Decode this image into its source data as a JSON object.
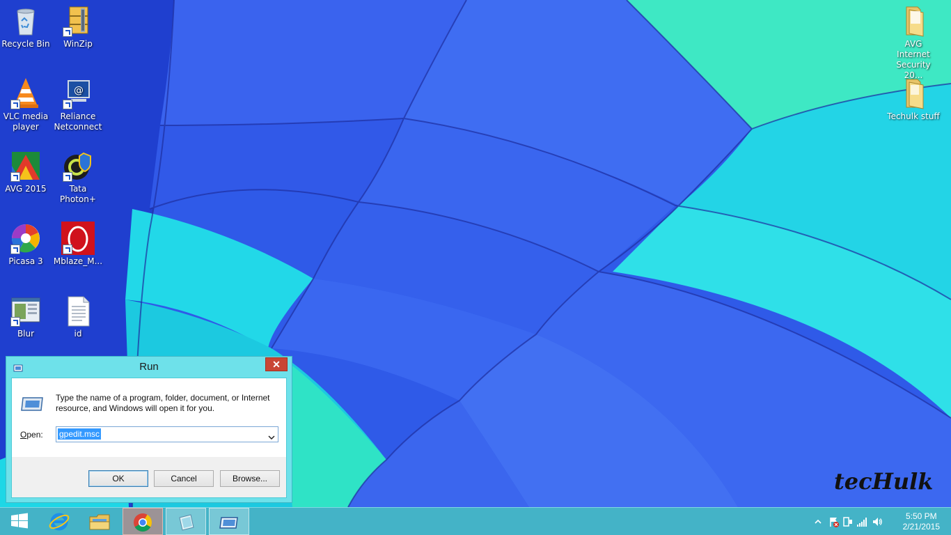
{
  "desktop": {
    "icons": [
      {
        "label": "Recycle Bin",
        "icon": "recycle-bin-icon"
      },
      {
        "label": "WinZip",
        "icon": "winzip-icon"
      },
      {
        "label": "VLC media player",
        "icon": "vlc-icon"
      },
      {
        "label": "Reliance Netconnect",
        "icon": "reliance-netconnect-icon"
      },
      {
        "label": "AVG 2015",
        "icon": "avg-icon"
      },
      {
        "label": "Tata Photon+",
        "icon": "tata-photon-icon"
      },
      {
        "label": "Picasa 3",
        "icon": "picasa-icon"
      },
      {
        "label": "Mblaze_M...",
        "icon": "mblaze-icon"
      },
      {
        "label": "Blur",
        "icon": "blur-app-icon"
      },
      {
        "label": "id",
        "icon": "text-file-icon"
      },
      {
        "label": "AVG Internet Security 20...",
        "icon": "folder-icon"
      },
      {
        "label": "Techulk stuff",
        "icon": "folder-icon"
      }
    ]
  },
  "run_dialog": {
    "title": "Run",
    "close_label": "✕",
    "description": "Type the name of a program, folder, document, or Internet resource, and Windows will open it for you.",
    "open_label_prefix": "",
    "open_label_accel": "O",
    "open_label_rest": "pen:",
    "open_value": "gpedit.msc",
    "ok_label": "OK",
    "cancel_label": "Cancel",
    "browse_label": "Browse..."
  },
  "watermark": {
    "text": "tecHulk"
  },
  "taskbar": {
    "items": [
      "start-button",
      "internet-explorer",
      "file-explorer",
      "google-chrome",
      "notepad",
      "run"
    ],
    "clock_time": "5:50 PM",
    "clock_date": "2/21/2015"
  },
  "colors": {
    "dialog_frame": "#6ee1ea",
    "taskbar": "#44b3c7",
    "selection": "#3399ff",
    "close_button": "#c94634"
  }
}
